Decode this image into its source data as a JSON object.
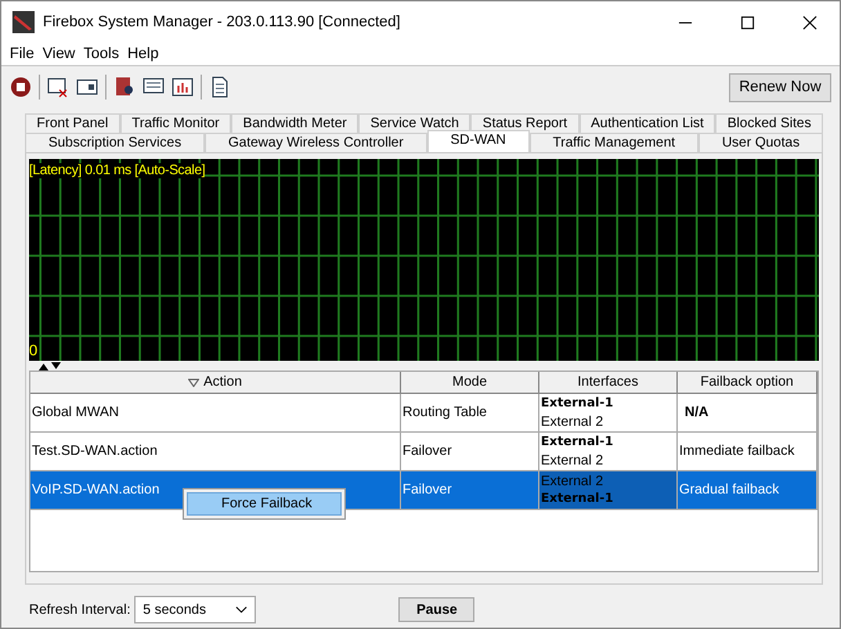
{
  "window": {
    "title": "Firebox System Manager - 203.0.113.90 [Connected]"
  },
  "menu": [
    "File",
    "View",
    "Tools",
    "Help"
  ],
  "toolbar": {
    "renew_button": "Renew Now"
  },
  "tab_rows": [
    [
      {
        "label": "Front Panel",
        "selected": false
      },
      {
        "label": "Traffic Monitor",
        "selected": false
      },
      {
        "label": "Bandwidth Meter",
        "selected": false
      },
      {
        "label": "Service Watch",
        "selected": false
      },
      {
        "label": "Status Report",
        "selected": false
      },
      {
        "label": "Authentication List",
        "selected": false
      },
      {
        "label": "Blocked Sites",
        "selected": false
      }
    ],
    [
      {
        "label": "Subscription Services",
        "selected": false
      },
      {
        "label": "Gateway Wireless Controller",
        "selected": false
      },
      {
        "label": "SD-WAN",
        "selected": true
      },
      {
        "label": "Traffic Management",
        "selected": false
      },
      {
        "label": "User Quotas",
        "selected": false
      }
    ]
  ],
  "graph": {
    "caption": "[Latency] 0.01 ms [Auto-Scale]",
    "baseline": "0"
  },
  "table": {
    "columns": [
      "Action",
      "Mode",
      "Interfaces",
      "Failback option"
    ],
    "rows": [
      {
        "action": "Global MWAN",
        "mode": "Routing Table",
        "interfaces": [
          {
            "name": "External-1",
            "active": true
          },
          {
            "name": "External 2",
            "active": false
          }
        ],
        "failback": "N/A",
        "failback_bold": true,
        "selected": false
      },
      {
        "action": "Test.SD-WAN.action",
        "mode": "Failover",
        "interfaces": [
          {
            "name": "External-1",
            "active": true
          },
          {
            "name": "External 2",
            "active": false
          }
        ],
        "failback": "Immediate failback",
        "failback_bold": false,
        "selected": false
      },
      {
        "action": "VoIP.SD-WAN.action",
        "mode": "Failover",
        "interfaces": [
          {
            "name": "External 2",
            "active": false
          },
          {
            "name": "External-1",
            "active": true
          }
        ],
        "failback": "Gradual failback",
        "failback_bold": false,
        "selected": true
      }
    ]
  },
  "context_menu": [
    "Force Failback"
  ],
  "footer": {
    "refresh_label": "Refresh Interval:",
    "refresh_value": "5 seconds",
    "pause_button": "Pause"
  }
}
